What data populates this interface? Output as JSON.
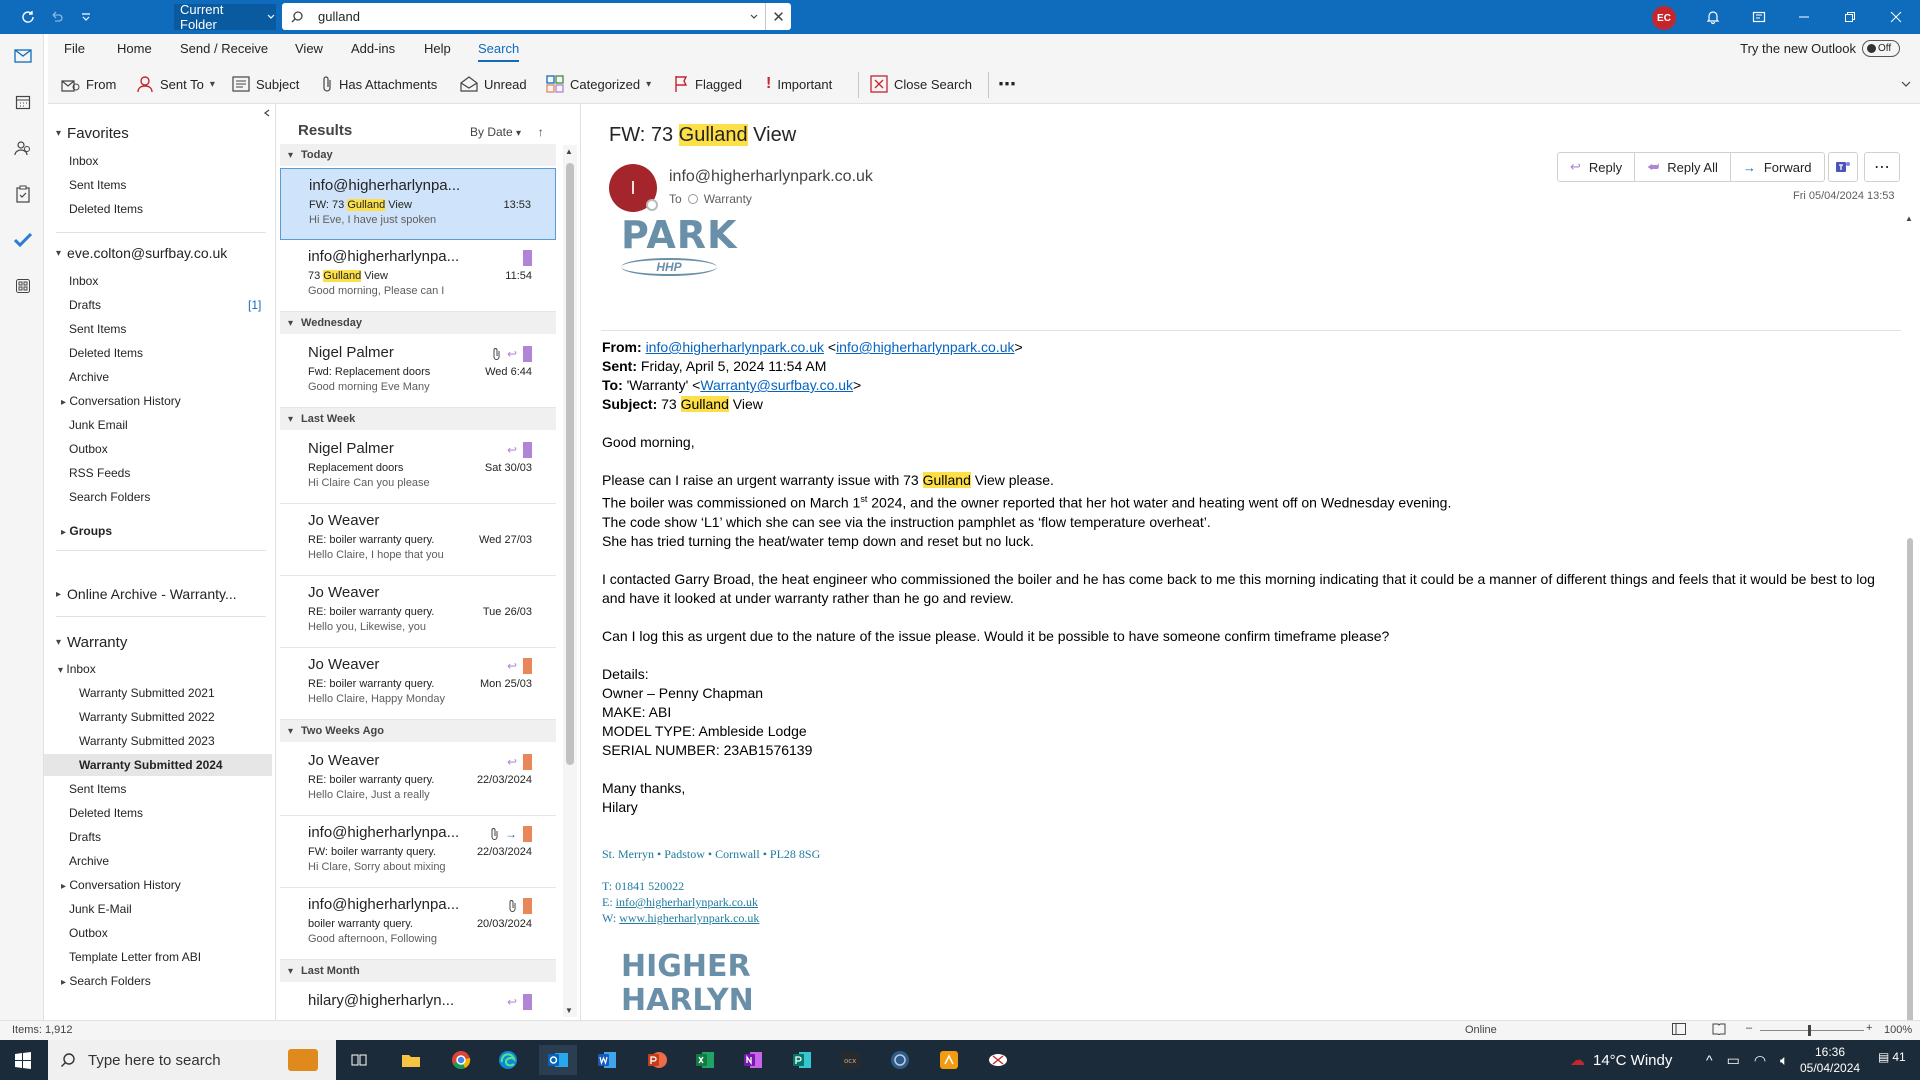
{
  "search": {
    "scope": "Current Folder",
    "query": "gulland"
  },
  "user": {
    "initials": "EC"
  },
  "menu": {
    "tabs": [
      "File",
      "Home",
      "Send / Receive",
      "View",
      "Add-ins",
      "Help",
      "Search"
    ],
    "active": "Search",
    "try_new": "Try the new Outlook",
    "toggle": "Off"
  },
  "ribbon": {
    "from": "From",
    "sent_to": "Sent To",
    "subject": "Subject",
    "has_attachments": "Has Attachments",
    "unread": "Unread",
    "categorized": "Categorized",
    "flagged": "Flagged",
    "important": "Important",
    "close_search": "Close Search"
  },
  "folders": {
    "favorites": {
      "title": "Favorites",
      "items": [
        "Inbox",
        "Sent Items",
        "Deleted Items"
      ]
    },
    "account": {
      "title": "eve.colton@surfbay.co.uk",
      "inbox": "Inbox",
      "drafts": "Drafts",
      "drafts_count": "[1]",
      "sent": "Sent Items",
      "deleted": "Deleted Items",
      "archive": "Archive",
      "conv": "Conversation History",
      "junk": "Junk Email",
      "outbox": "Outbox",
      "rss": "RSS Feeds",
      "searchf": "Search Folders"
    },
    "groups": "Groups",
    "online_archive": "Online Archive - Warranty...",
    "warranty": {
      "title": "Warranty",
      "inbox": "Inbox",
      "sub": [
        "Warranty Submitted 2021",
        "Warranty Submitted 2022",
        "Warranty Submitted 2023",
        "Warranty Submitted 2024"
      ],
      "sent": "Sent Items",
      "deleted": "Deleted Items",
      "drafts": "Drafts",
      "archive": "Archive",
      "conv": "Conversation History",
      "junk": "Junk E-Mail",
      "outbox": "Outbox",
      "template": "Template Letter from ABI",
      "searchf": "Search Folders"
    }
  },
  "results": {
    "title": "Results",
    "sort": "By Date",
    "groups": [
      "Today",
      "Wednesday",
      "Last Week",
      "Two Weeks Ago",
      "Last Month"
    ],
    "messages": [
      {
        "sender": "info@higherharlynpa...",
        "subject_pre": "FW: 73 ",
        "subject_hl": "Gulland",
        "subject_post": " View",
        "preview": "Hi Eve,  I have just spoken",
        "time": "13:53"
      },
      {
        "sender": "info@higherharlynpa...",
        "subject_pre": "73 ",
        "subject_hl": "Gulland",
        "subject_post": " View",
        "preview": "Good morning,  Please can I",
        "time": "11:54"
      },
      {
        "sender": "Nigel Palmer",
        "subject": "Fwd: Replacement doors",
        "preview": "Good morning Eve  Many",
        "time": "Wed 6:44"
      },
      {
        "sender": "Nigel Palmer",
        "subject": "Replacement doors",
        "preview": "Hi Claire  Can you please",
        "time": "Sat 30/03"
      },
      {
        "sender": "Jo Weaver",
        "subject": "RE: boiler warranty query.",
        "preview": "Hello Claire,  I hope that you",
        "time": "Wed 27/03"
      },
      {
        "sender": "Jo Weaver",
        "subject": "RE: boiler warranty query.",
        "preview": "Hello you,  Likewise, you",
        "time": "Tue 26/03"
      },
      {
        "sender": "Jo Weaver",
        "subject": "RE: boiler warranty query.",
        "preview": "Hello Claire,  Happy Monday",
        "time": "Mon 25/03"
      },
      {
        "sender": "Jo Weaver",
        "subject": "RE: boiler warranty query.",
        "preview": "Hello Claire,  Just a really",
        "time": "22/03/2024"
      },
      {
        "sender": "info@higherharlynpa...",
        "subject": "FW: boiler warranty query.",
        "preview": "Hi Clare,  Sorry about mixing",
        "time": "22/03/2024"
      },
      {
        "sender": "info@higherharlynpa...",
        "subject": "boiler warranty query.",
        "preview": "Good afternoon,  Following",
        "time": "20/03/2024"
      },
      {
        "sender": "hilary@higherharlyn..."
      }
    ]
  },
  "email": {
    "title_pre": "FW: 73 ",
    "title_hl": "Gulland",
    "title_post": " View",
    "avatar": "I",
    "from": "info@higherharlynpark.co.uk",
    "to_label": "To",
    "to": "Warranty",
    "date": "Fri 05/04/2024 13:53",
    "actions": {
      "reply": "Reply",
      "reply_all": "Reply All",
      "forward": "Forward"
    },
    "logo_top": "PARK",
    "logo_sub": "HHP",
    "logo_bottom_1": "HIGHER",
    "logo_bottom_2": "HARLYN",
    "hdr_from_label": "From:",
    "hdr_from_1": "info@higherharlynpark.co.uk",
    "hdr_from_2": "info@higherharlynpark.co.uk",
    "hdr_sent_label": "Sent:",
    "hdr_sent": "Friday, April 5, 2024 11:54 AM",
    "hdr_to_label": "To:",
    "hdr_to_name": "'Warranty'",
    "hdr_to_addr": "Warranty@surfbay.co.uk",
    "hdr_subject_label": "Subject:",
    "greeting": "Good morning,",
    "p1_pre": "Please can I raise an urgent warranty issue with 73 ",
    "p1_hl": "Gulland",
    "p1_post": " View please.",
    "p1_l2_pre": "The boiler was commissioned on March 1",
    "p1_l2_sup": "st",
    "p1_l2_post": " 2024, and the owner reported that her hot water and heating went off on Wednesday evening.",
    "p1_l3": "The code show ‘L1’ which she can see via the instruction pamphlet as ‘flow temperature overheat’.",
    "p1_l4": "She has tried turning the heat/water temp down and reset but no luck.",
    "p2": "I contacted Garry Broad, the heat engineer who commissioned the boiler and he has come back to me this morning indicating that it could be a manner of different things and feels that it would be best to log and have it looked at under warranty rather than he go and review.",
    "p3": "Can I log this as urgent due to the nature of the issue please. Would it be possible to have someone confirm timeframe please?",
    "details": [
      "Details:",
      "Owner – Penny Chapman",
      "MAKE: ABI",
      "MODEL TYPE: Ambleside Lodge",
      "SERIAL NUMBER: 23AB1576139"
    ],
    "signoff": [
      "Many thanks,",
      "Hilary"
    ],
    "sig_addr": "St. Merryn • Padstow • Cornwall • PL28 8SG",
    "sig_tel": "T: 01841 520022",
    "sig_email_label": "E: ",
    "sig_email": "info@higherharlynpark.co.uk",
    "sig_web_label": "W: ",
    "sig_web": "www.higherharlynpark.co.uk"
  },
  "status": {
    "items": "Items: 1,912",
    "online": "Online",
    "zoom": "100%"
  },
  "taskbar": {
    "search_placeholder": "Type here to search",
    "weather": "14°C  Windy",
    "time": "16:36",
    "date": "05/04/2024",
    "notif": "41"
  },
  "colors": {
    "accent": "#0f6cbd",
    "highlight": "#fde047",
    "cat_purple": "#b084d6",
    "cat_orange": "#e8875a"
  }
}
